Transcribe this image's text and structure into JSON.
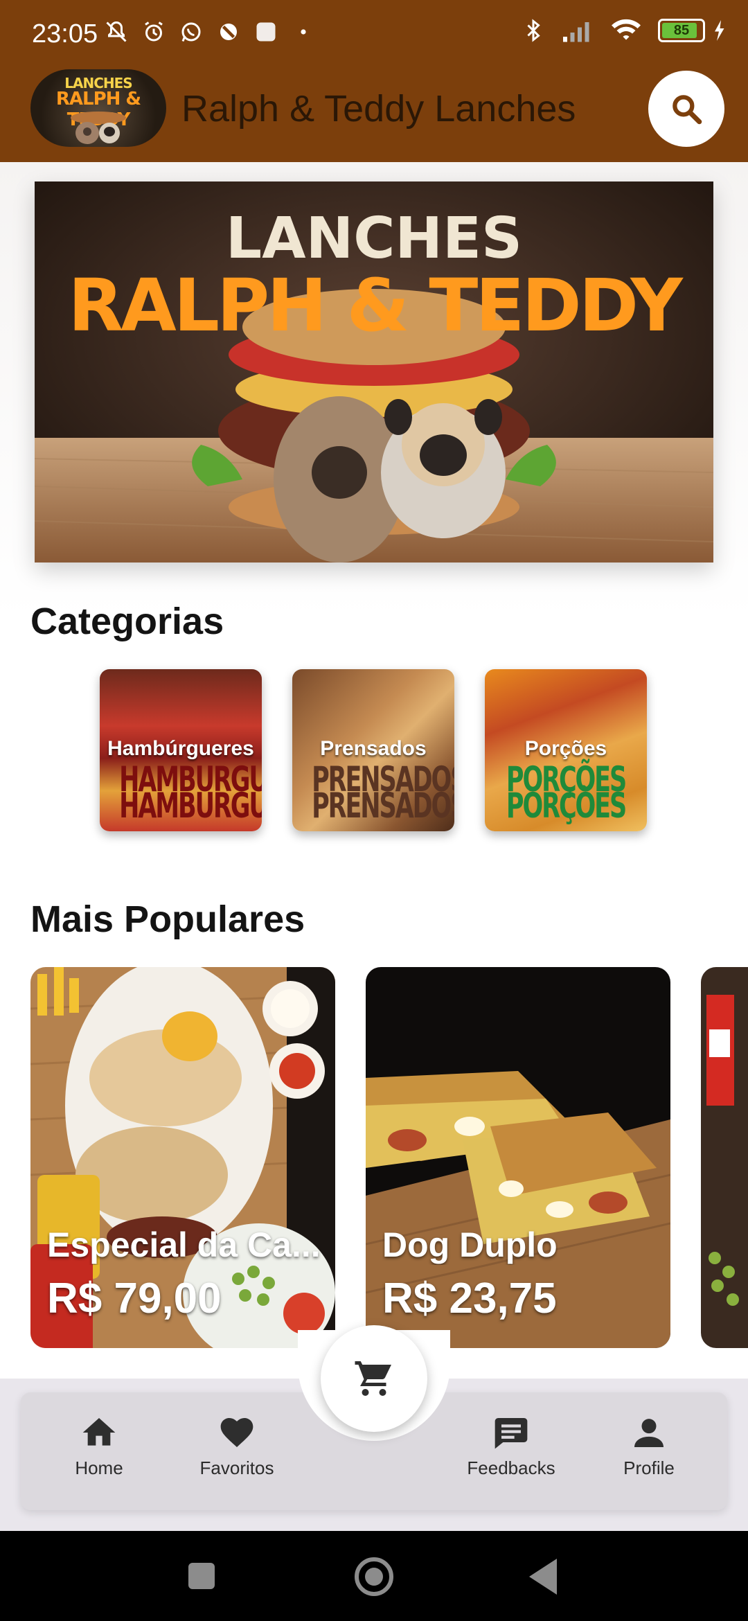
{
  "status_bar": {
    "time": "23:05",
    "battery": "85"
  },
  "app": {
    "title": "Ralph & Teddy Lanches",
    "logo": {
      "line1": "LANCHES",
      "line2": "RALPH & TEDDY"
    },
    "search_icon": "search-icon"
  },
  "banner": {
    "line1": "LANCHES",
    "line2": "RALPH & TEDDY"
  },
  "categories": {
    "title": "Categorias",
    "items": [
      {
        "label": "Hambúrgueres",
        "overlay": "HAMBURGUER",
        "overlay_color": "#7d0e0e"
      },
      {
        "label": "Prensados",
        "overlay": "PRENSADOS",
        "overlay_color": "#5a3422"
      },
      {
        "label": "Porções",
        "overlay": "PORÇÕES",
        "overlay_color": "#1f8a3a"
      }
    ]
  },
  "popular": {
    "title": "Mais Populares",
    "items": [
      {
        "name": "Especial da Ca...",
        "price": "R$ 79,00"
      },
      {
        "name": "Dog Duplo",
        "price": "R$ 23,75"
      }
    ]
  },
  "bottom_nav": {
    "items": [
      {
        "label": "Home",
        "icon": "home-icon"
      },
      {
        "label": "Favoritos",
        "icon": "heart-icon"
      },
      {
        "label": "Feedbacks",
        "icon": "chat-icon"
      },
      {
        "label": "Profile",
        "icon": "person-icon"
      }
    ],
    "cart_icon": "cart-icon"
  },
  "colors": {
    "appbar": "#7c3f0c",
    "accent_orange": "#ff9a1e",
    "nav_bg": "#dcd9de"
  }
}
